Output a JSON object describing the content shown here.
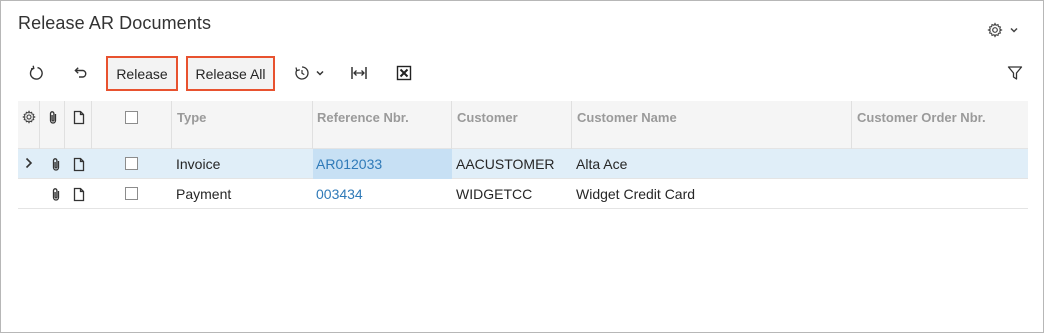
{
  "page": {
    "title": "Release AR Documents"
  },
  "toolbar": {
    "release_label": "Release",
    "release_all_label": "Release All",
    "icons": [
      "refresh-icon",
      "undo-icon",
      "schedule-icon",
      "fit-width-icon",
      "export-excel-icon",
      "filter-icon"
    ]
  },
  "grid": {
    "columns": [
      "Type",
      "Reference Nbr.",
      "Customer",
      "Customer Name",
      "Customer Order Nbr."
    ],
    "rows": [
      {
        "type": "Invoice",
        "ref": "AR012033",
        "customer": "AACUSTOMER",
        "customer_name": "Alta Ace",
        "order_nbr": ""
      },
      {
        "type": "Payment",
        "ref": "003434",
        "customer": "WIDGETCC",
        "customer_name": "Widget Credit Card",
        "order_nbr": ""
      }
    ]
  },
  "colors": {
    "accent_border": "#e8522f",
    "link": "#2f7ab8",
    "selected_row": "#e0eef8"
  }
}
